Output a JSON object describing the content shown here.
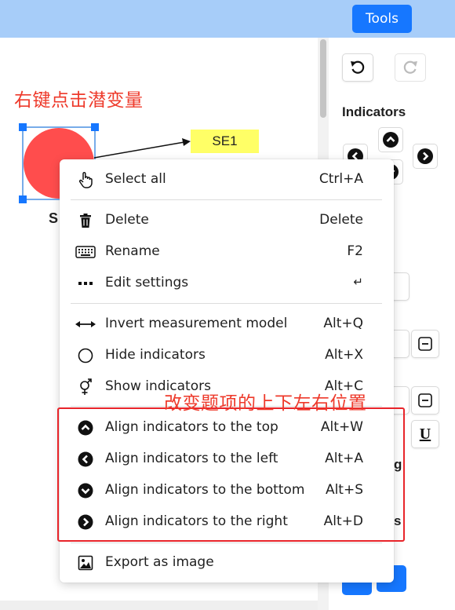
{
  "header": {
    "tools_label": "Tools"
  },
  "panel": {
    "indicators_title": "Indicators",
    "partial_labels": [
      "g",
      "s"
    ],
    "underline_label": "U"
  },
  "diagram": {
    "annotation_right_click": "右键点击潜变量",
    "node_label_partial": "S",
    "indicator_label": "SE1"
  },
  "menu": {
    "items": [
      {
        "icon": "hand-pointer-icon",
        "label": "Select all",
        "shortcut": "Ctrl+A"
      },
      {
        "icon": "trash-icon",
        "label": "Delete",
        "shortcut": "Delete"
      },
      {
        "icon": "keyboard-icon",
        "label": "Rename",
        "shortcut": "F2"
      },
      {
        "icon": "ellipsis-icon",
        "label": "Edit settings",
        "shortcut": "↵"
      },
      {
        "icon": "double-arrow-icon",
        "label": "Invert measurement model",
        "shortcut": "Alt+Q"
      },
      {
        "icon": "circle-outline-icon",
        "label": "Hide indicators",
        "shortcut": "Alt+X"
      },
      {
        "icon": "gender-symbol-icon",
        "label": "Show indicators",
        "shortcut": "Alt+C"
      },
      {
        "icon": "circle-chevron-up-icon",
        "label": "Align indicators to the top",
        "shortcut": "Alt+W"
      },
      {
        "icon": "circle-chevron-left-icon",
        "label": "Align indicators to the left",
        "shortcut": "Alt+A"
      },
      {
        "icon": "circle-chevron-down-icon",
        "label": "Align indicators to the bottom",
        "shortcut": "Alt+S"
      },
      {
        "icon": "circle-chevron-right-icon",
        "label": "Align indicators to the right",
        "shortcut": "Alt+D"
      },
      {
        "icon": "image-icon",
        "label": "Export as image",
        "shortcut": ""
      }
    ]
  },
  "annotation_align": "改变题项的上下左右位置",
  "colors": {
    "topbar": "#a7cdf9",
    "accent": "#1677ff",
    "annotation_red": "#ee3a2b",
    "node_fill": "#ff4d4d",
    "indicator_fill": "#ffff66"
  }
}
